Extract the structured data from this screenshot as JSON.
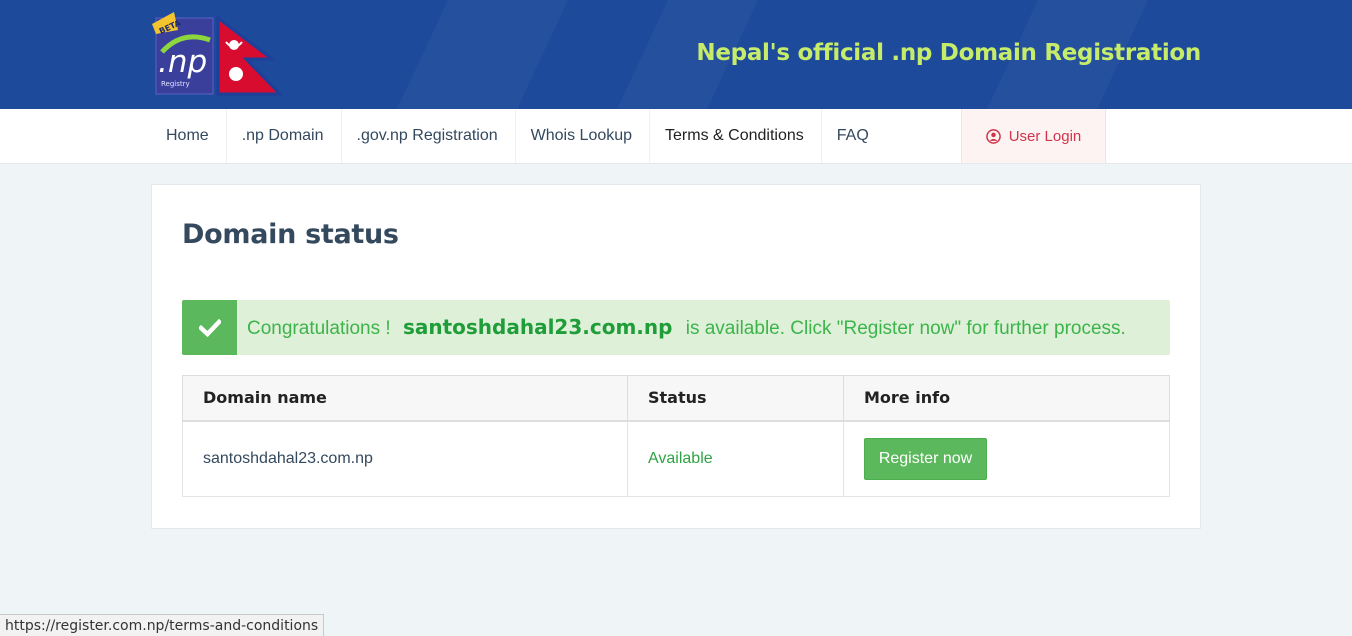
{
  "header": {
    "tagline": "Nepal's official .np Domain Registration",
    "logo": {
      "badge": "BETA",
      "mark": ".np",
      "sub": "Registry"
    },
    "colors": {
      "background": "#1e4a9b",
      "tagline": "#c6ec6a"
    }
  },
  "nav": {
    "items": [
      {
        "label": "Home"
      },
      {
        "label": ".np Domain"
      },
      {
        "label": ".gov.np Registration"
      },
      {
        "label": "Whois Lookup"
      },
      {
        "label": "Terms & Conditions"
      },
      {
        "label": "FAQ"
      }
    ],
    "login_label": "User Login"
  },
  "main": {
    "title": "Domain status",
    "alert": {
      "prefix": "Congratulations !",
      "domain": "santoshdahal23.com.np",
      "suffix": "is available. Click \"Register now\" for further process."
    },
    "table": {
      "headers": [
        "Domain name",
        "Status",
        "More info"
      ],
      "rows": [
        {
          "domain": "santoshdahal23.com.np",
          "status": "Available",
          "action": "Register now"
        }
      ]
    }
  },
  "statusbar": {
    "url": "https://register.com.np/terms-and-conditions"
  }
}
